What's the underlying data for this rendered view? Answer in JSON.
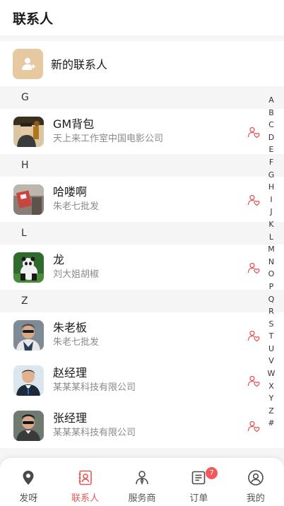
{
  "header": {
    "title": "联系人"
  },
  "new_contact": {
    "label": "新的联系人",
    "icon": "add-user-icon"
  },
  "sections": [
    {
      "letter": "G",
      "contacts": [
        {
          "name": "GM背包",
          "subtitle": "天上来工作室中国电影公司"
        }
      ]
    },
    {
      "letter": "H",
      "contacts": [
        {
          "name": "哈喽啊",
          "subtitle": "朱老七批发"
        }
      ]
    },
    {
      "letter": "L",
      "contacts": [
        {
          "name": "龙",
          "subtitle": "刘大姐胡椒"
        }
      ]
    },
    {
      "letter": "Z",
      "contacts": [
        {
          "name": "朱老板",
          "subtitle": "朱老七批发"
        },
        {
          "name": "赵经理",
          "subtitle": "某某某科技有限公司"
        },
        {
          "name": "张经理",
          "subtitle": "某某某科技有限公司"
        }
      ]
    }
  ],
  "index_letters": [
    "A",
    "B",
    "C",
    "D",
    "E",
    "F",
    "G",
    "H",
    "I",
    "J",
    "K",
    "L",
    "M",
    "N",
    "O",
    "P",
    "Q",
    "R",
    "S",
    "T",
    "U",
    "V",
    "W",
    "X",
    "Y",
    "Z",
    "#"
  ],
  "tabs": [
    {
      "label": "发呀",
      "icon": "location-pin-icon",
      "active": false
    },
    {
      "label": "联系人",
      "icon": "contacts-book-icon",
      "active": true
    },
    {
      "label": "服务商",
      "icon": "user-tie-icon",
      "active": false
    },
    {
      "label": "订单",
      "icon": "order-list-icon",
      "active": false,
      "badge": "7"
    },
    {
      "label": "我的",
      "icon": "profile-icon",
      "active": false
    }
  ],
  "colors": {
    "accent": "#e05a5a",
    "badge": "#f25a5a",
    "new_contact_bg": "#e6c9a0",
    "background": "#f5f5f5"
  }
}
